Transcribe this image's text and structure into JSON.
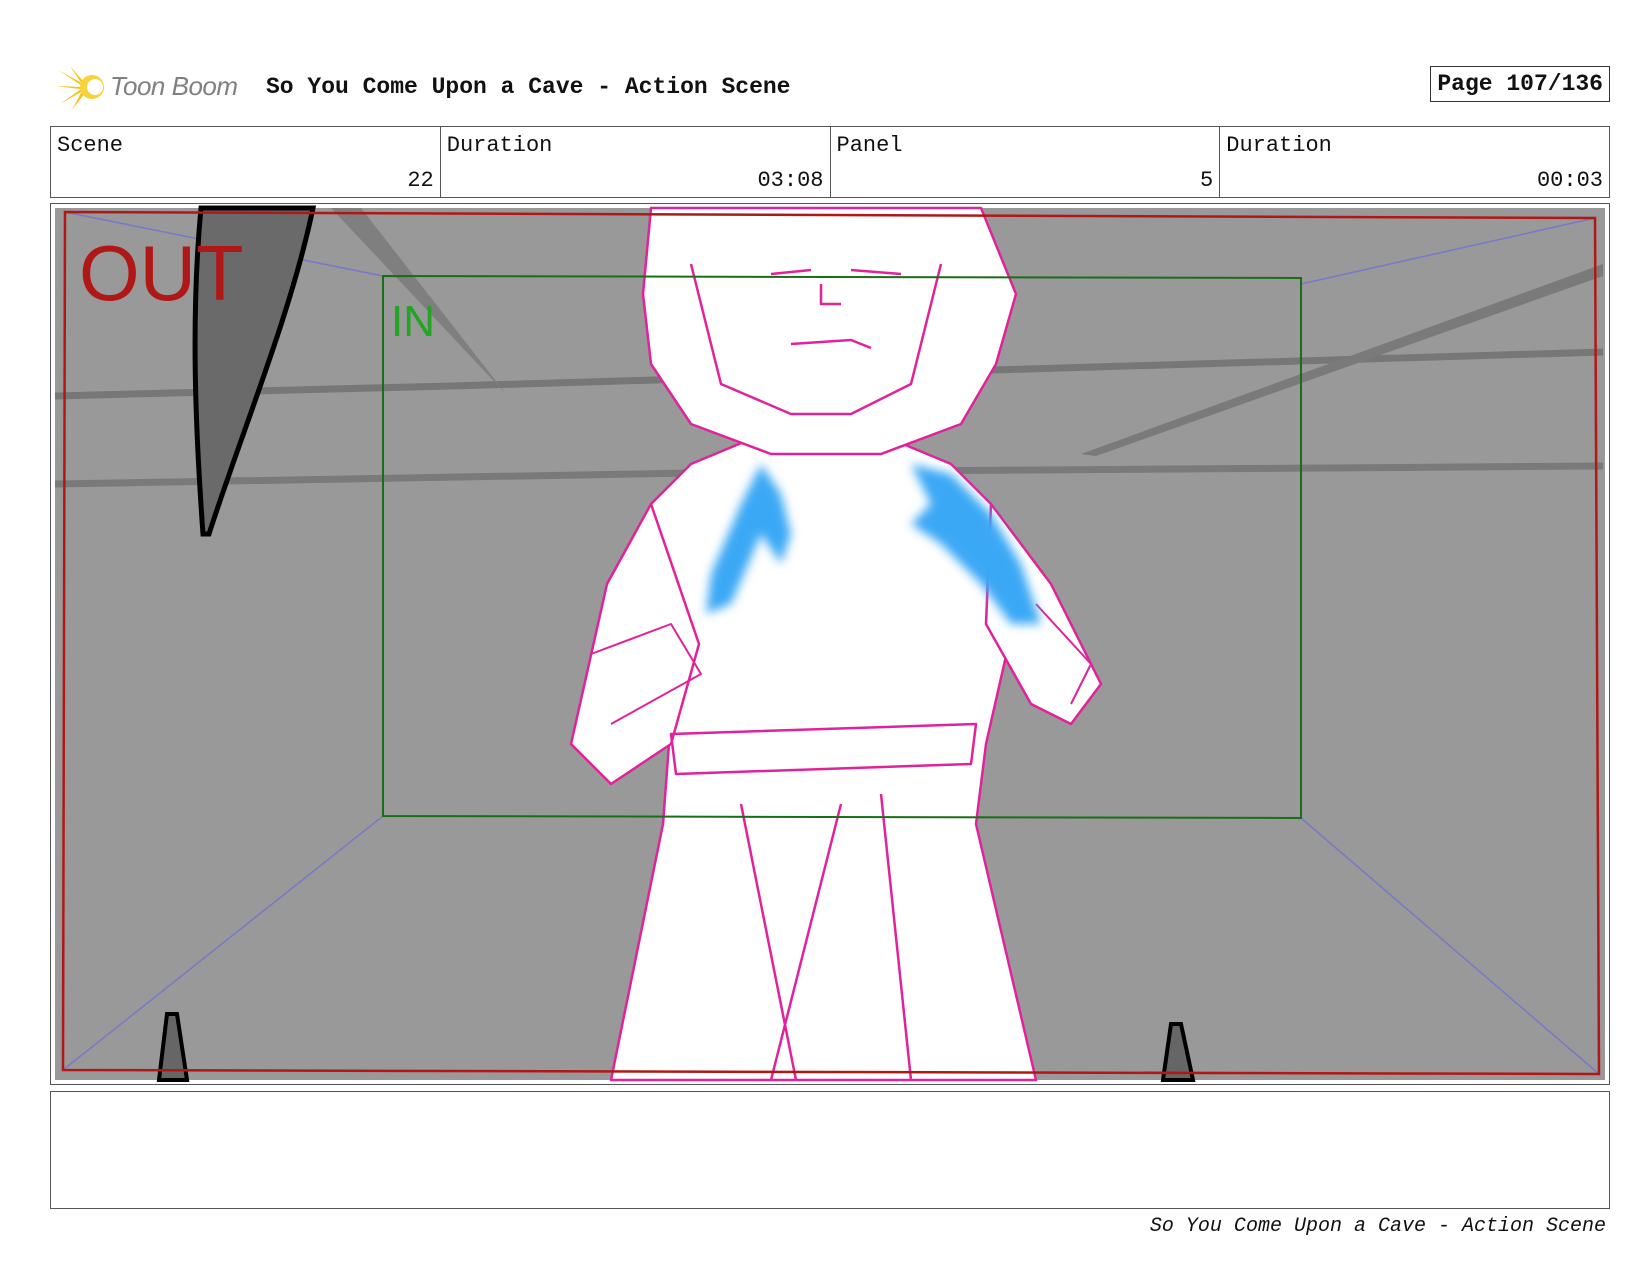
{
  "header": {
    "logo_text": "Toon Boom",
    "title": "So You Come Upon a Cave - Action Scene",
    "page_label": "Page 107/136"
  },
  "info": {
    "scene_label": "Scene",
    "scene_value": "22",
    "scene_duration_label": "Duration",
    "scene_duration_value": "03:08",
    "panel_label": "Panel",
    "panel_value": "5",
    "panel_duration_label": "Duration",
    "panel_duration_value": "00:03"
  },
  "panel": {
    "out_label": "OUT",
    "in_label": "IN"
  },
  "colors": {
    "out_frame": "#b01818",
    "in_frame": "#1a6e1a",
    "sketch_line": "#e0239a",
    "glow": "#3aa8f5",
    "background": "#999999"
  },
  "footer": {
    "title": "So You Come Upon a Cave - Action Scene"
  }
}
